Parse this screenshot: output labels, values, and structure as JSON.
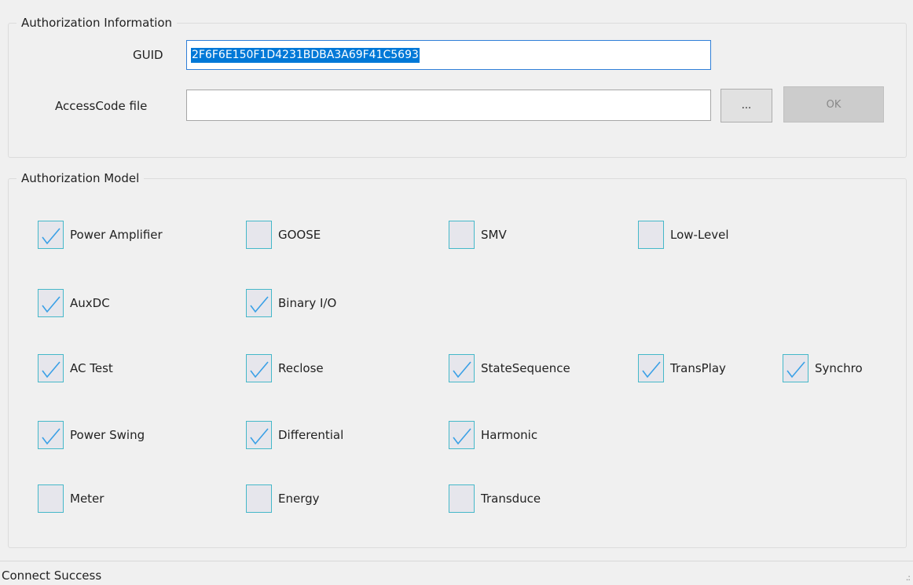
{
  "auth_info": {
    "title": "Authorization Information",
    "guid_label": "GUID",
    "guid_value": "2F6F6E150F1D4231BDBA3A69F41C5693",
    "access_label": "AccessCode file",
    "access_value": "",
    "browse_label": "...",
    "ok_label": "OK"
  },
  "auth_model": {
    "title": "Authorization Model",
    "items": [
      {
        "label": "Power Amplifier",
        "checked": true
      },
      {
        "label": "GOOSE",
        "checked": false
      },
      {
        "label": "SMV",
        "checked": false
      },
      {
        "label": "Low-Level",
        "checked": false
      },
      {
        "label": "AuxDC",
        "checked": true
      },
      {
        "label": "Binary I/O",
        "checked": true
      },
      {
        "label": "AC Test",
        "checked": true
      },
      {
        "label": "Reclose",
        "checked": true
      },
      {
        "label": "StateSequence",
        "checked": true
      },
      {
        "label": "TransPlay",
        "checked": true
      },
      {
        "label": "Synchro",
        "checked": true
      },
      {
        "label": "Power Swing",
        "checked": true
      },
      {
        "label": "Differential",
        "checked": true
      },
      {
        "label": "Harmonic",
        "checked": true
      },
      {
        "label": "Meter",
        "checked": false
      },
      {
        "label": "Energy",
        "checked": false
      },
      {
        "label": "Transduce",
        "checked": false
      }
    ]
  },
  "status": {
    "text": "Connect Success"
  },
  "colors": {
    "check_border": "#45b8c9",
    "check_mark": "#3aa0e6",
    "selection": "#0078d7"
  }
}
